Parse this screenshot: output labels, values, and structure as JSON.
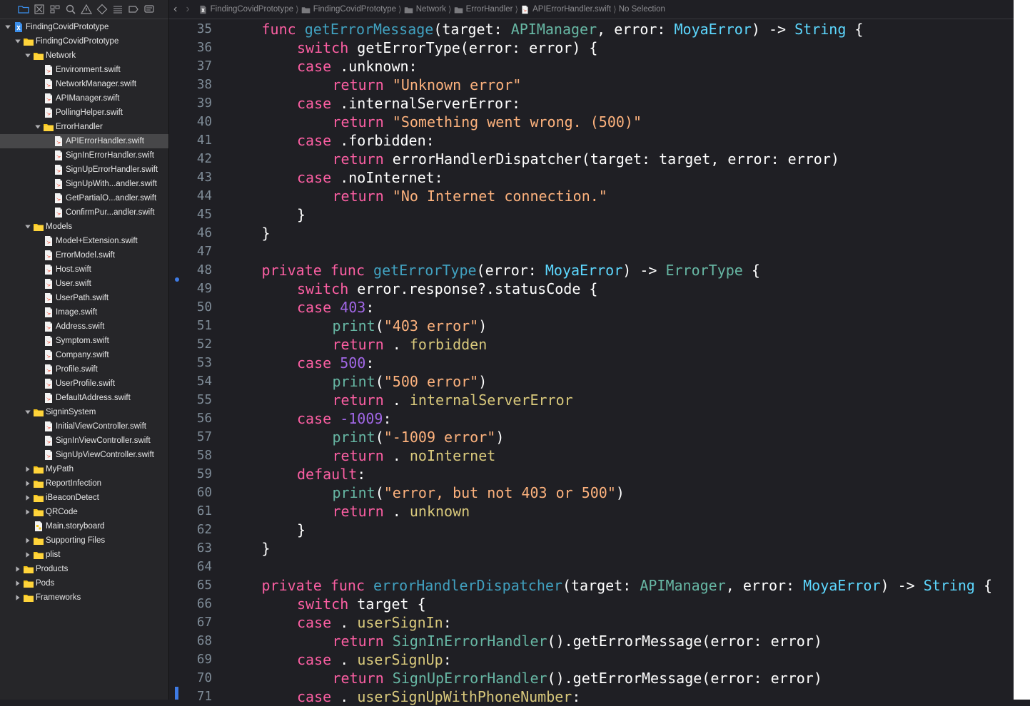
{
  "jump_bar": {
    "items": [
      {
        "label": "FindingCovidPrototype",
        "icon": "project-icon"
      },
      {
        "label": "FindingCovidPrototype",
        "icon": "folder-icon"
      },
      {
        "label": "Network",
        "icon": "folder-icon"
      },
      {
        "label": "ErrorHandler",
        "icon": "folder-icon"
      },
      {
        "label": "APIErrorHandler.swift",
        "icon": "swift-file-icon"
      },
      {
        "label": "No Selection",
        "icon": ""
      }
    ]
  },
  "navigator_toolbar": [
    "folder-icon",
    "source-control-icon",
    "symbol-icon",
    "search-icon",
    "warning-icon",
    "test-icon",
    "debug-icon",
    "breakpoint-icon",
    "report-icon"
  ],
  "tree": [
    {
      "label": "FindingCovidPrototype",
      "level": 0,
      "kind": "project",
      "expanded": true
    },
    {
      "label": "FindingCovidPrototype",
      "level": 1,
      "kind": "folder",
      "expanded": true
    },
    {
      "label": "Network",
      "level": 2,
      "kind": "folder",
      "expanded": true
    },
    {
      "label": "Environment.swift",
      "level": 3,
      "kind": "file"
    },
    {
      "label": "NetworkManager.swift",
      "level": 3,
      "kind": "file"
    },
    {
      "label": "APIManager.swift",
      "level": 3,
      "kind": "file"
    },
    {
      "label": "PollingHelper.swift",
      "level": 3,
      "kind": "file"
    },
    {
      "label": "ErrorHandler",
      "level": 3,
      "kind": "folder",
      "expanded": true
    },
    {
      "label": "APIErrorHandler.swift",
      "level": 4,
      "kind": "file",
      "selected": true
    },
    {
      "label": "SignInErrorHandler.swift",
      "level": 4,
      "kind": "file"
    },
    {
      "label": "SignUpErrorHandler.swift",
      "level": 4,
      "kind": "file"
    },
    {
      "label": "SignUpWith...andler.swift",
      "level": 4,
      "kind": "file"
    },
    {
      "label": "GetPartialO...andler.swift",
      "level": 4,
      "kind": "file"
    },
    {
      "label": "ConfirmPur...andler.swift",
      "level": 4,
      "kind": "file"
    },
    {
      "label": "Models",
      "level": 2,
      "kind": "folder",
      "expanded": true
    },
    {
      "label": "Model+Extension.swift",
      "level": 3,
      "kind": "file"
    },
    {
      "label": "ErrorModel.swift",
      "level": 3,
      "kind": "file"
    },
    {
      "label": "Host.swift",
      "level": 3,
      "kind": "file"
    },
    {
      "label": "User.swift",
      "level": 3,
      "kind": "file"
    },
    {
      "label": "UserPath.swift",
      "level": 3,
      "kind": "file"
    },
    {
      "label": "Image.swift",
      "level": 3,
      "kind": "file"
    },
    {
      "label": "Address.swift",
      "level": 3,
      "kind": "file"
    },
    {
      "label": "Symptom.swift",
      "level": 3,
      "kind": "file"
    },
    {
      "label": "Company.swift",
      "level": 3,
      "kind": "file"
    },
    {
      "label": "Profile.swift",
      "level": 3,
      "kind": "file"
    },
    {
      "label": "UserProfile.swift",
      "level": 3,
      "kind": "file"
    },
    {
      "label": "DefaultAddress.swift",
      "level": 3,
      "kind": "file"
    },
    {
      "label": "SigninSystem",
      "level": 2,
      "kind": "folder",
      "expanded": true
    },
    {
      "label": "InitialViewController.swift",
      "level": 3,
      "kind": "file"
    },
    {
      "label": "SignInViewController.swift",
      "level": 3,
      "kind": "file"
    },
    {
      "label": "SignUpViewController.swift",
      "level": 3,
      "kind": "file"
    },
    {
      "label": "MyPath",
      "level": 2,
      "kind": "folder",
      "expanded": false
    },
    {
      "label": "ReportInfection",
      "level": 2,
      "kind": "folder",
      "expanded": false
    },
    {
      "label": "iBeaconDetect",
      "level": 2,
      "kind": "folder",
      "expanded": false
    },
    {
      "label": "QRCode",
      "level": 2,
      "kind": "folder",
      "expanded": false
    },
    {
      "label": "Main.storyboard",
      "level": 2,
      "kind": "storyboard"
    },
    {
      "label": "Supporting Files",
      "level": 2,
      "kind": "folder",
      "expanded": false
    },
    {
      "label": "plist",
      "level": 2,
      "kind": "folder",
      "expanded": false
    },
    {
      "label": "Products",
      "level": 1,
      "kind": "folder",
      "expanded": false
    },
    {
      "label": "Pods",
      "level": 1,
      "kind": "folder",
      "expanded": false
    },
    {
      "label": "Frameworks",
      "level": 1,
      "kind": "folder",
      "expanded": false
    }
  ],
  "code_lines": [
    {
      "n": "35",
      "i": 1,
      "t": [
        [
          "k",
          "func "
        ],
        [
          "f",
          "getErrorMessage"
        ],
        [
          "",
          "(target: "
        ],
        [
          "p",
          "APIManager"
        ],
        [
          "",
          ", error: "
        ],
        [
          "t",
          "MoyaError"
        ],
        [
          "",
          ") -> "
        ],
        [
          "t",
          "String"
        ],
        [
          "",
          " {"
        ]
      ]
    },
    {
      "n": "36",
      "i": 2,
      "t": [
        [
          "k",
          "switch "
        ],
        [
          "",
          "getErrorType(error: error) {"
        ]
      ]
    },
    {
      "n": "37",
      "i": 2,
      "t": [
        [
          "k",
          "case "
        ],
        [
          "",
          ".unknown:"
        ]
      ]
    },
    {
      "n": "38",
      "i": 3,
      "t": [
        [
          "k",
          "return "
        ],
        [
          "g",
          "\"Unknown error\""
        ]
      ]
    },
    {
      "n": "39",
      "i": 2,
      "t": [
        [
          "k",
          "case "
        ],
        [
          "",
          ".internalServerError:"
        ]
      ]
    },
    {
      "n": "40",
      "i": 3,
      "t": [
        [
          "k",
          "return "
        ],
        [
          "g",
          "\"Something went wrong. (500)\""
        ]
      ]
    },
    {
      "n": "41",
      "i": 2,
      "t": [
        [
          "k",
          "case "
        ],
        [
          "",
          ".forbidden:"
        ]
      ]
    },
    {
      "n": "42",
      "i": 3,
      "t": [
        [
          "k",
          "return "
        ],
        [
          "",
          "errorHandlerDispatcher(target: target, error: error)"
        ]
      ]
    },
    {
      "n": "43",
      "i": 2,
      "t": [
        [
          "k",
          "case "
        ],
        [
          "",
          ".noInternet:"
        ]
      ]
    },
    {
      "n": "44",
      "i": 3,
      "t": [
        [
          "k",
          "return "
        ],
        [
          "g",
          "\"No Internet connection.\""
        ]
      ]
    },
    {
      "n": "45",
      "i": 2,
      "t": [
        [
          "",
          "}"
        ]
      ]
    },
    {
      "n": "46",
      "i": 1,
      "t": [
        [
          "",
          "}"
        ]
      ]
    },
    {
      "n": "47",
      "i": 0,
      "t": []
    },
    {
      "n": "48",
      "i": 1,
      "t": [
        [
          "k",
          "private func "
        ],
        [
          "f",
          "getErrorType"
        ],
        [
          "",
          "(error: "
        ],
        [
          "t",
          "MoyaError"
        ],
        [
          "",
          ") -> "
        ],
        [
          "p",
          "ErrorType"
        ],
        [
          "",
          " {"
        ]
      ]
    },
    {
      "n": "49",
      "i": 2,
      "t": [
        [
          "k",
          "switch "
        ],
        [
          "",
          "error.response?.statusCode {"
        ]
      ]
    },
    {
      "n": "50",
      "i": 2,
      "t": [
        [
          "k",
          "case "
        ],
        [
          "e",
          "403"
        ],
        [
          "",
          ":"
        ]
      ]
    },
    {
      "n": "51",
      "i": 3,
      "t": [
        [
          "p",
          "print"
        ],
        [
          "",
          "("
        ],
        [
          "g",
          "\"403 error\""
        ],
        [
          "",
          ")"
        ]
      ]
    },
    {
      "n": "52",
      "i": 3,
      "t": [
        [
          "k",
          "return "
        ],
        [
          "",
          ". "
        ],
        [
          "m",
          "forbidden"
        ]
      ]
    },
    {
      "n": "53",
      "i": 2,
      "t": [
        [
          "k",
          "case "
        ],
        [
          "e",
          "500"
        ],
        [
          "",
          ":"
        ]
      ]
    },
    {
      "n": "54",
      "i": 3,
      "t": [
        [
          "p",
          "print"
        ],
        [
          "",
          "("
        ],
        [
          "g",
          "\"500 error\""
        ],
        [
          "",
          ")"
        ]
      ]
    },
    {
      "n": "55",
      "i": 3,
      "t": [
        [
          "k",
          "return "
        ],
        [
          "",
          ". "
        ],
        [
          "m",
          "internalServerError"
        ]
      ]
    },
    {
      "n": "56",
      "i": 2,
      "t": [
        [
          "k",
          "case "
        ],
        [
          "e",
          "-1009"
        ],
        [
          "",
          ":"
        ]
      ]
    },
    {
      "n": "57",
      "i": 3,
      "t": [
        [
          "p",
          "print"
        ],
        [
          "",
          "("
        ],
        [
          "g",
          "\"-1009 error\""
        ],
        [
          "",
          ")"
        ]
      ]
    },
    {
      "n": "58",
      "i": 3,
      "t": [
        [
          "k",
          "return "
        ],
        [
          "",
          ". "
        ],
        [
          "m",
          "noInternet"
        ]
      ]
    },
    {
      "n": "59",
      "i": 2,
      "t": [
        [
          "k",
          "default"
        ],
        [
          "",
          ":"
        ]
      ]
    },
    {
      "n": "60",
      "i": 3,
      "t": [
        [
          "p",
          "print"
        ],
        [
          "",
          "("
        ],
        [
          "g",
          "\"error, but not 403 or 500\""
        ],
        [
          "",
          ")"
        ]
      ]
    },
    {
      "n": "61",
      "i": 3,
      "t": [
        [
          "k",
          "return "
        ],
        [
          "",
          ". "
        ],
        [
          "m",
          "unknown"
        ]
      ]
    },
    {
      "n": "62",
      "i": 2,
      "t": [
        [
          "",
          "}"
        ]
      ]
    },
    {
      "n": "63",
      "i": 1,
      "t": [
        [
          "",
          "}"
        ]
      ]
    },
    {
      "n": "64",
      "i": 0,
      "t": []
    },
    {
      "n": "65",
      "i": 1,
      "t": [
        [
          "k",
          "private func "
        ],
        [
          "f",
          "errorHandlerDispatcher"
        ],
        [
          "",
          "(target: "
        ],
        [
          "p",
          "APIManager"
        ],
        [
          "",
          ", error: "
        ],
        [
          "t",
          "MoyaError"
        ],
        [
          "",
          ") -> "
        ],
        [
          "t",
          "String"
        ],
        [
          "",
          " {"
        ]
      ]
    },
    {
      "n": "66",
      "i": 2,
      "t": [
        [
          "k",
          "switch "
        ],
        [
          "",
          "target {"
        ]
      ]
    },
    {
      "n": "67",
      "i": 2,
      "t": [
        [
          "k",
          "case "
        ],
        [
          "",
          ". "
        ],
        [
          "m",
          "userSignIn"
        ],
        [
          "",
          ":"
        ]
      ]
    },
    {
      "n": "68",
      "i": 3,
      "t": [
        [
          "k",
          "return "
        ],
        [
          "p",
          "SignInErrorHandler"
        ],
        [
          "",
          "().getErrorMessage(error: error)"
        ]
      ]
    },
    {
      "n": "69",
      "i": 2,
      "t": [
        [
          "k",
          "case "
        ],
        [
          "",
          ". "
        ],
        [
          "m",
          "userSignUp"
        ],
        [
          "",
          ":"
        ]
      ]
    },
    {
      "n": "70",
      "i": 3,
      "t": [
        [
          "k",
          "return "
        ],
        [
          "p",
          "SignUpErrorHandler"
        ],
        [
          "",
          "().getErrorMessage(error: error)"
        ]
      ]
    },
    {
      "n": "71",
      "i": 2,
      "t": [
        [
          "k",
          "case "
        ],
        [
          "",
          ". "
        ],
        [
          "m",
          "userSignUpWithPhoneNumber"
        ],
        [
          "",
          ":"
        ]
      ]
    }
  ]
}
